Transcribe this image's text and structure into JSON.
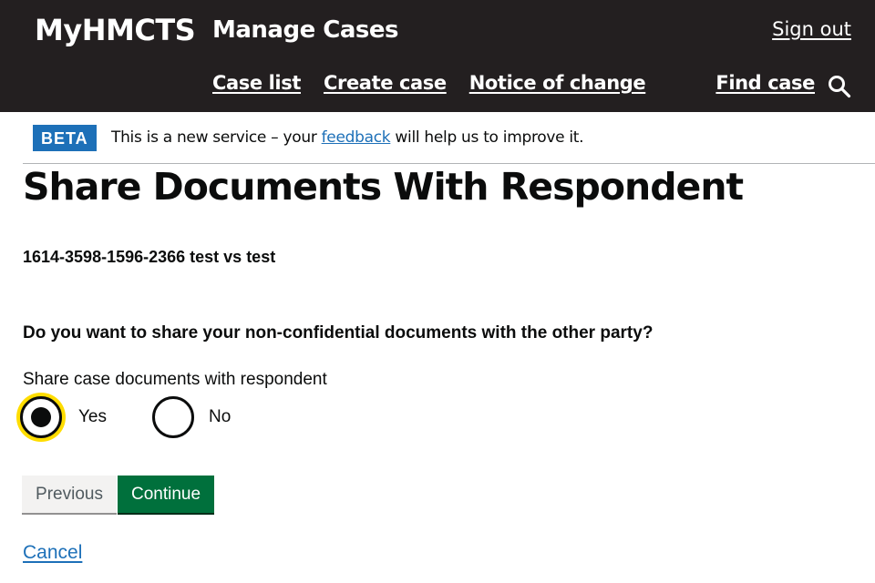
{
  "header": {
    "brand": "MyHMCTS",
    "service_name": "Manage Cases",
    "sign_out": "Sign out",
    "nav": [
      "Case list",
      "Create case",
      "Notice of change"
    ],
    "find_case": "Find case",
    "search_icon": "search-icon"
  },
  "beta_banner": {
    "tag": "BETA",
    "text_before": "This is a new service – your ",
    "link": "feedback",
    "text_after": " will help us to improve it."
  },
  "page": {
    "title": "Share Documents With Respondent",
    "case_reference": "1614-3598-1596-2366 test vs test",
    "question": "Do you want to share your non-confidential documents with the other party?",
    "field_label": "Share case documents with respondent",
    "options": [
      {
        "label": "Yes",
        "selected": true
      },
      {
        "label": "No",
        "selected": false
      }
    ]
  },
  "buttons": {
    "previous": "Previous",
    "continue": "Continue",
    "cancel": "Cancel"
  },
  "colors": {
    "header_bg": "#231f20",
    "beta_tag": "#1d70b8",
    "link": "#1d70b8",
    "continue_button": "#00703c",
    "focus": "#ffdd00"
  }
}
